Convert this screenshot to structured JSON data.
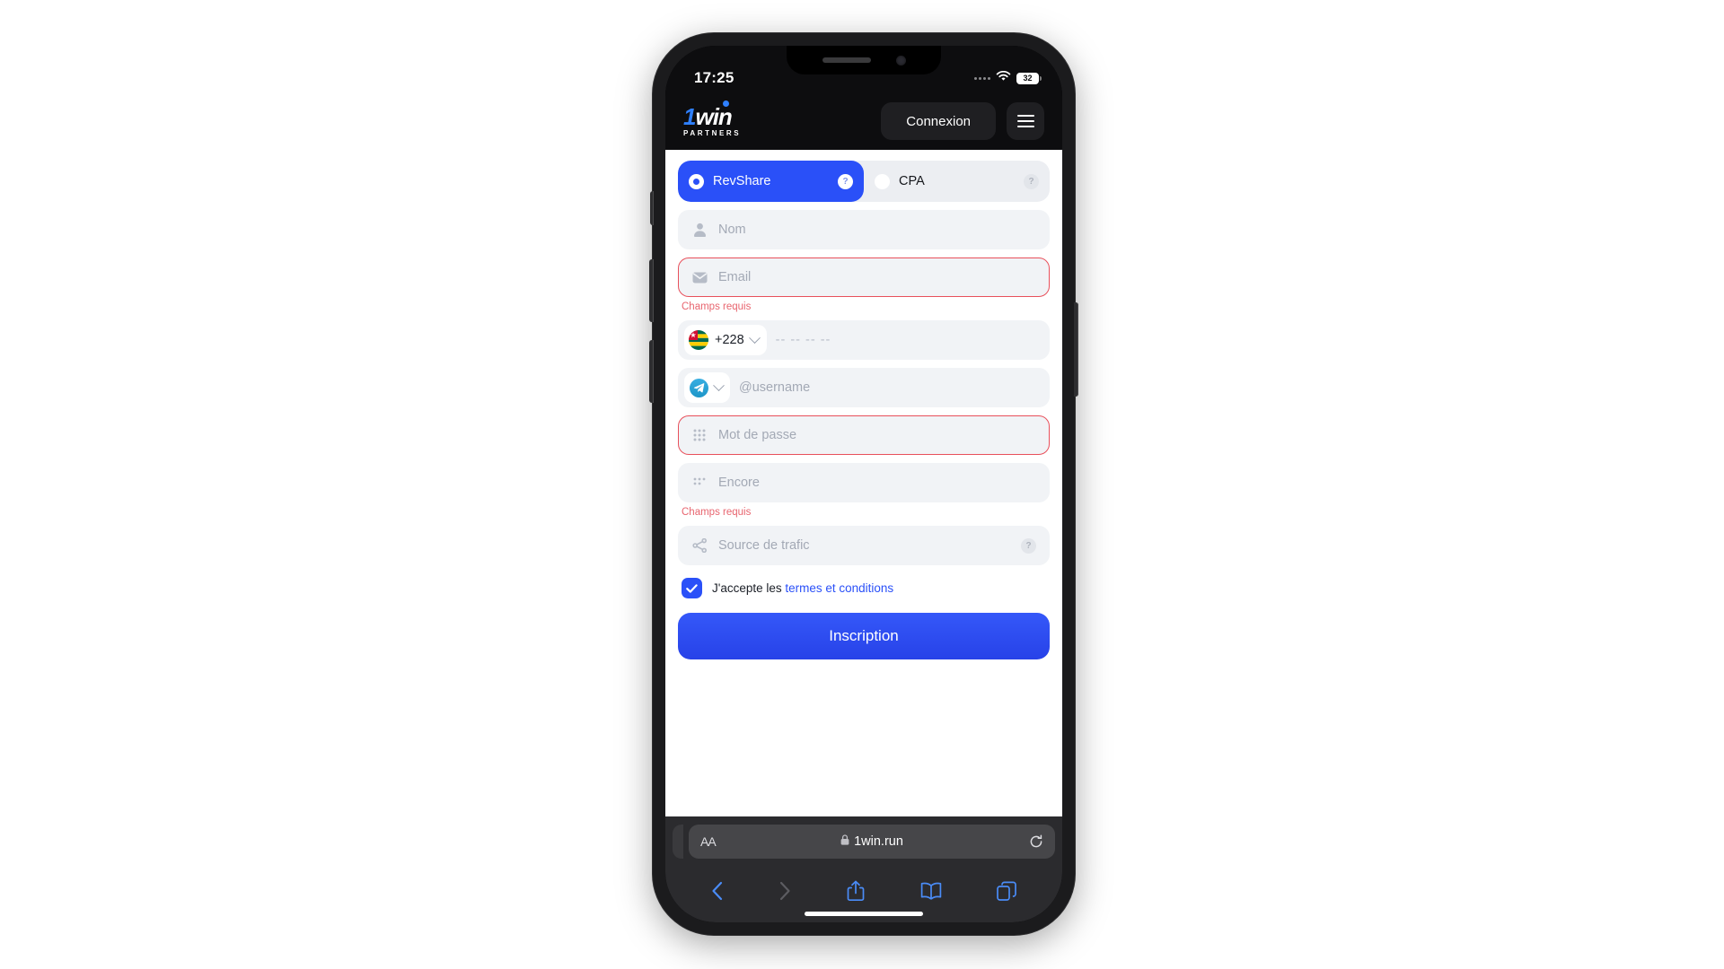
{
  "status_bar": {
    "time": "17:25",
    "battery_level": "32",
    "icons": [
      "signal-dots-icon",
      "wifi-icon",
      "battery-icon"
    ]
  },
  "site_header": {
    "logo_one": "1",
    "logo_win": "win",
    "logo_sub": "PARTNERS",
    "login_label": "Connexion",
    "menu_icon": "hamburger-menu-icon"
  },
  "form": {
    "plan_toggle": [
      {
        "label": "RevShare",
        "selected": true,
        "help": "?"
      },
      {
        "label": "CPA",
        "selected": false,
        "help": "?"
      }
    ],
    "fields": [
      {
        "name": "name",
        "icon": "user-icon",
        "placeholder": "Nom",
        "value": "",
        "error": ""
      },
      {
        "name": "email",
        "icon": "envelope-icon",
        "placeholder": "Email",
        "value": "",
        "error": "Champs requis"
      },
      {
        "name": "phone",
        "icon": "flag-icon",
        "placeholder": "-- -- -- --",
        "value": "",
        "error": "",
        "dial_code": "+228",
        "country": "Togo"
      },
      {
        "name": "telegram",
        "icon": "telegram-icon",
        "placeholder": "@username",
        "value": "",
        "error": ""
      },
      {
        "name": "password",
        "icon": "keypad-icon",
        "placeholder": "Mot de passe",
        "value": "",
        "error": ""
      },
      {
        "name": "password2",
        "icon": "keypad-icon",
        "placeholder": "Encore",
        "value": "",
        "error": "Champs requis"
      },
      {
        "name": "traffic",
        "icon": "share-icon",
        "placeholder": "Source de trafic",
        "value": "",
        "error": "",
        "help": "?"
      }
    ],
    "terms": {
      "checked": true,
      "text": "J'accepte les ",
      "link": "termes et conditions"
    },
    "submit_label": "Inscription"
  },
  "browser": {
    "text_size_label": "AA",
    "lock_icon": "lock-icon",
    "url": "1win.run",
    "reload_icon": "reload-icon",
    "toolbar": [
      {
        "name": "back",
        "icon": "chevron-left-icon",
        "enabled": true
      },
      {
        "name": "forward",
        "icon": "chevron-right-icon",
        "enabled": false
      },
      {
        "name": "share",
        "icon": "share-arrow-icon",
        "enabled": true
      },
      {
        "name": "bookmarks",
        "icon": "book-icon",
        "enabled": true
      },
      {
        "name": "tabs",
        "icon": "tabs-icon",
        "enabled": true
      }
    ]
  },
  "colors": {
    "accent_blue": "#2a50f8",
    "error_red": "#e8505b",
    "field_bg": "#f1f3f6",
    "phone_frame": "#1b1b1d"
  }
}
